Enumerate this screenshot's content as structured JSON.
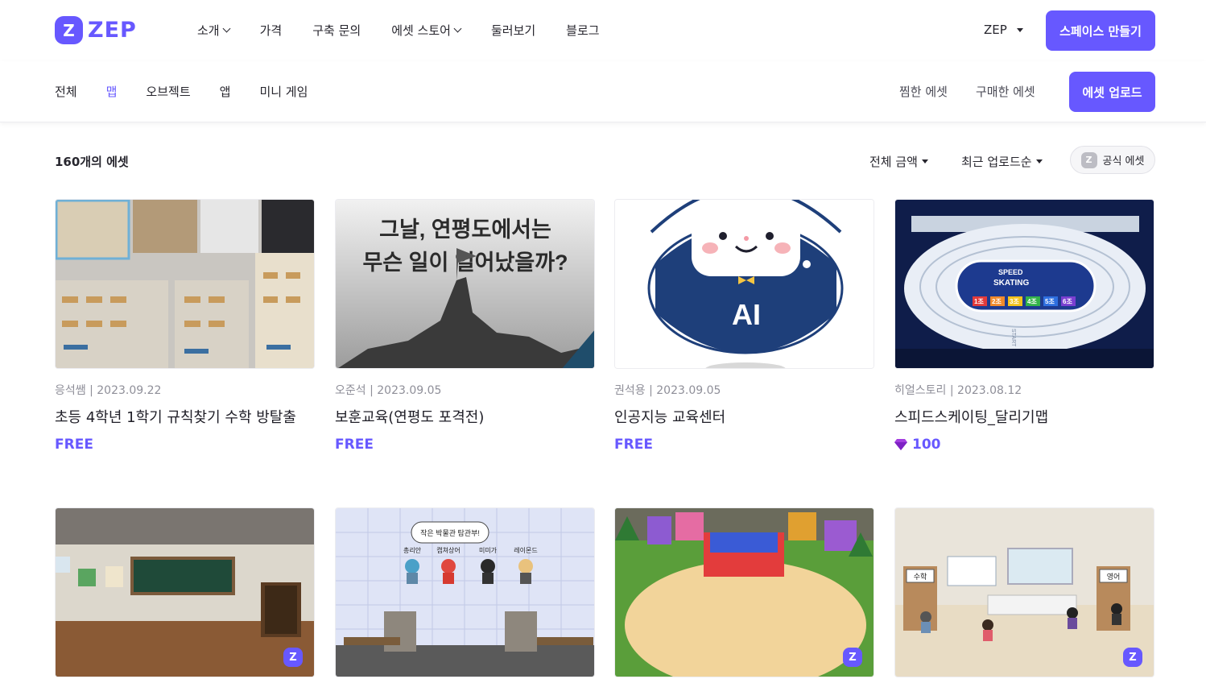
{
  "brand": {
    "logo_mark": "Z",
    "logo_text": "ZEP"
  },
  "nav": [
    {
      "label": "소개",
      "dropdown": true
    },
    {
      "label": "가격",
      "dropdown": false
    },
    {
      "label": "구축 문의",
      "dropdown": false
    },
    {
      "label": "에셋 스토어",
      "dropdown": true
    },
    {
      "label": "둘러보기",
      "dropdown": false
    },
    {
      "label": "블로그",
      "dropdown": false
    }
  ],
  "header": {
    "language": "ZEP",
    "create_space": "스페이스 만들기"
  },
  "categories": [
    {
      "label": "전체",
      "active": false
    },
    {
      "label": "맵",
      "active": true
    },
    {
      "label": "오브젝트",
      "active": false
    },
    {
      "label": "앱",
      "active": false
    },
    {
      "label": "미니 게임",
      "active": false
    }
  ],
  "sublinks": {
    "liked": "찜한 에셋",
    "purchased": "구매한 에셋",
    "upload": "에셋 업로드"
  },
  "toolbar": {
    "count": "160개의 에셋",
    "price_filter": "전체 금액",
    "sort": "최근 업로드순",
    "official": "공식 에셋",
    "official_icon": "Z"
  },
  "colors": {
    "accent": "#6758ff"
  },
  "cards": [
    {
      "author": "응석쌤",
      "date": "2023.09.22",
      "title": "초등 4학년 1학기 규칙찾기 수학 방탈출",
      "price": "FREE",
      "gem": false
    },
    {
      "author": "오준석",
      "date": "2023.09.05",
      "title": "보훈교육(연평도 포격전)",
      "price": "FREE",
      "gem": false,
      "thumb_text": [
        "그날, 연평도에서는",
        "무슨 일이 일어났을까?"
      ]
    },
    {
      "author": "권석용",
      "date": "2023.09.05",
      "title": "인공지능 교육센터",
      "price": "FREE",
      "gem": false,
      "thumb_text": [
        "AI"
      ]
    },
    {
      "author": "히얼스토리",
      "date": "2023.08.12",
      "title": "스피드스케이팅_달리기맵",
      "price": "100",
      "gem": true,
      "thumb_text": [
        "SPEED",
        "SKATING",
        "1조",
        "2조",
        "3조",
        "4조",
        "5조",
        "6조",
        "START"
      ]
    },
    {
      "author": "",
      "date": "",
      "title": "",
      "price": "",
      "gem": false,
      "official": "Z"
    },
    {
      "author": "",
      "date": "",
      "title": "",
      "price": "",
      "gem": false,
      "thumb_text": [
        "작은 박물관 탐관부!",
        "총리안",
        "캡쳐상어",
        "미미가",
        "레이몬드"
      ]
    },
    {
      "author": "",
      "date": "",
      "title": "",
      "price": "",
      "gem": false,
      "official": "Z"
    },
    {
      "author": "",
      "date": "",
      "title": "",
      "price": "",
      "gem": false,
      "official": "Z",
      "thumb_text": [
        "수학",
        "영어"
      ]
    }
  ]
}
